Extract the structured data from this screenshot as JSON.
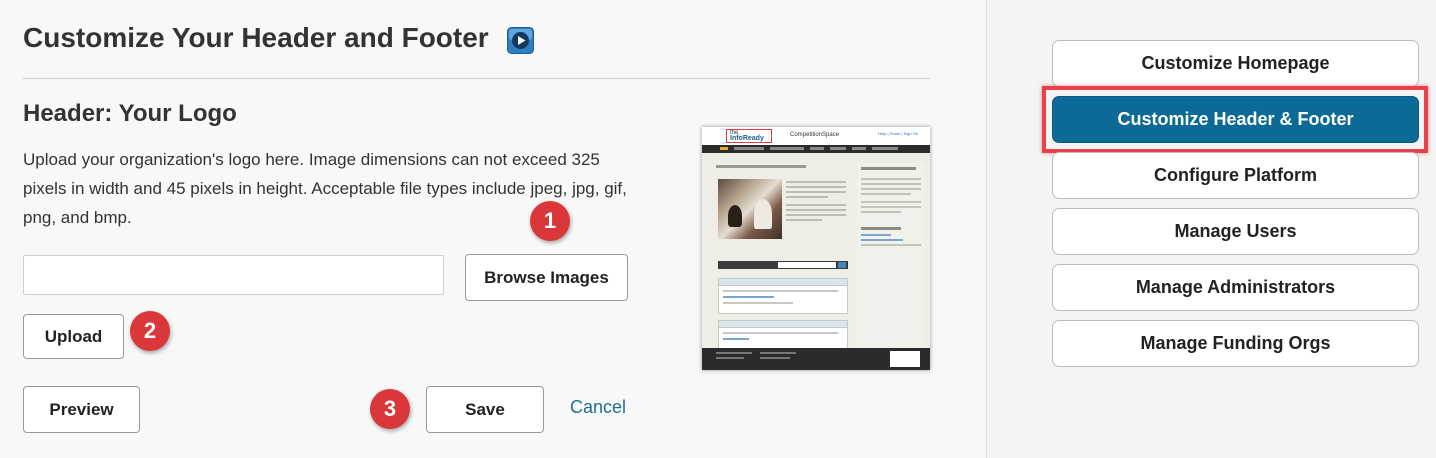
{
  "page": {
    "title": "Customize Your Header and Footer",
    "video_icon": "video-play-icon"
  },
  "header_section": {
    "title": "Header: Your Logo",
    "description": "Upload your organization's logo here. Image dimensions can not exceed 325 pixels in width and 45 pixels in height. Acceptable file types include jpeg, jpg, gif, png, and bmp.",
    "file_input_value": "",
    "browse_label": "Browse Images",
    "upload_label": "Upload"
  },
  "actions": {
    "preview_label": "Preview",
    "save_label": "Save",
    "cancel_label": "Cancel"
  },
  "step_badges": [
    "1",
    "2",
    "3"
  ],
  "preview_thumbnail": {
    "logo_text_small": "the",
    "logo_text": "InfoReady",
    "site_name": "CompetitionSpace",
    "top_links": "Help | Home | Sign On"
  },
  "sidebar": {
    "items": [
      {
        "label": "Customize Homepage",
        "active": false
      },
      {
        "label": "Customize Header & Footer",
        "active": true
      },
      {
        "label": "Configure Platform",
        "active": false
      },
      {
        "label": "Manage Users",
        "active": false
      },
      {
        "label": "Manage Administrators",
        "active": false
      },
      {
        "label": "Manage Funding Orgs",
        "active": false
      }
    ]
  },
  "colors": {
    "accent": "#0c6a96",
    "badge": "#d9373a",
    "highlight": "#e8414a",
    "link": "#1f6f8b"
  }
}
